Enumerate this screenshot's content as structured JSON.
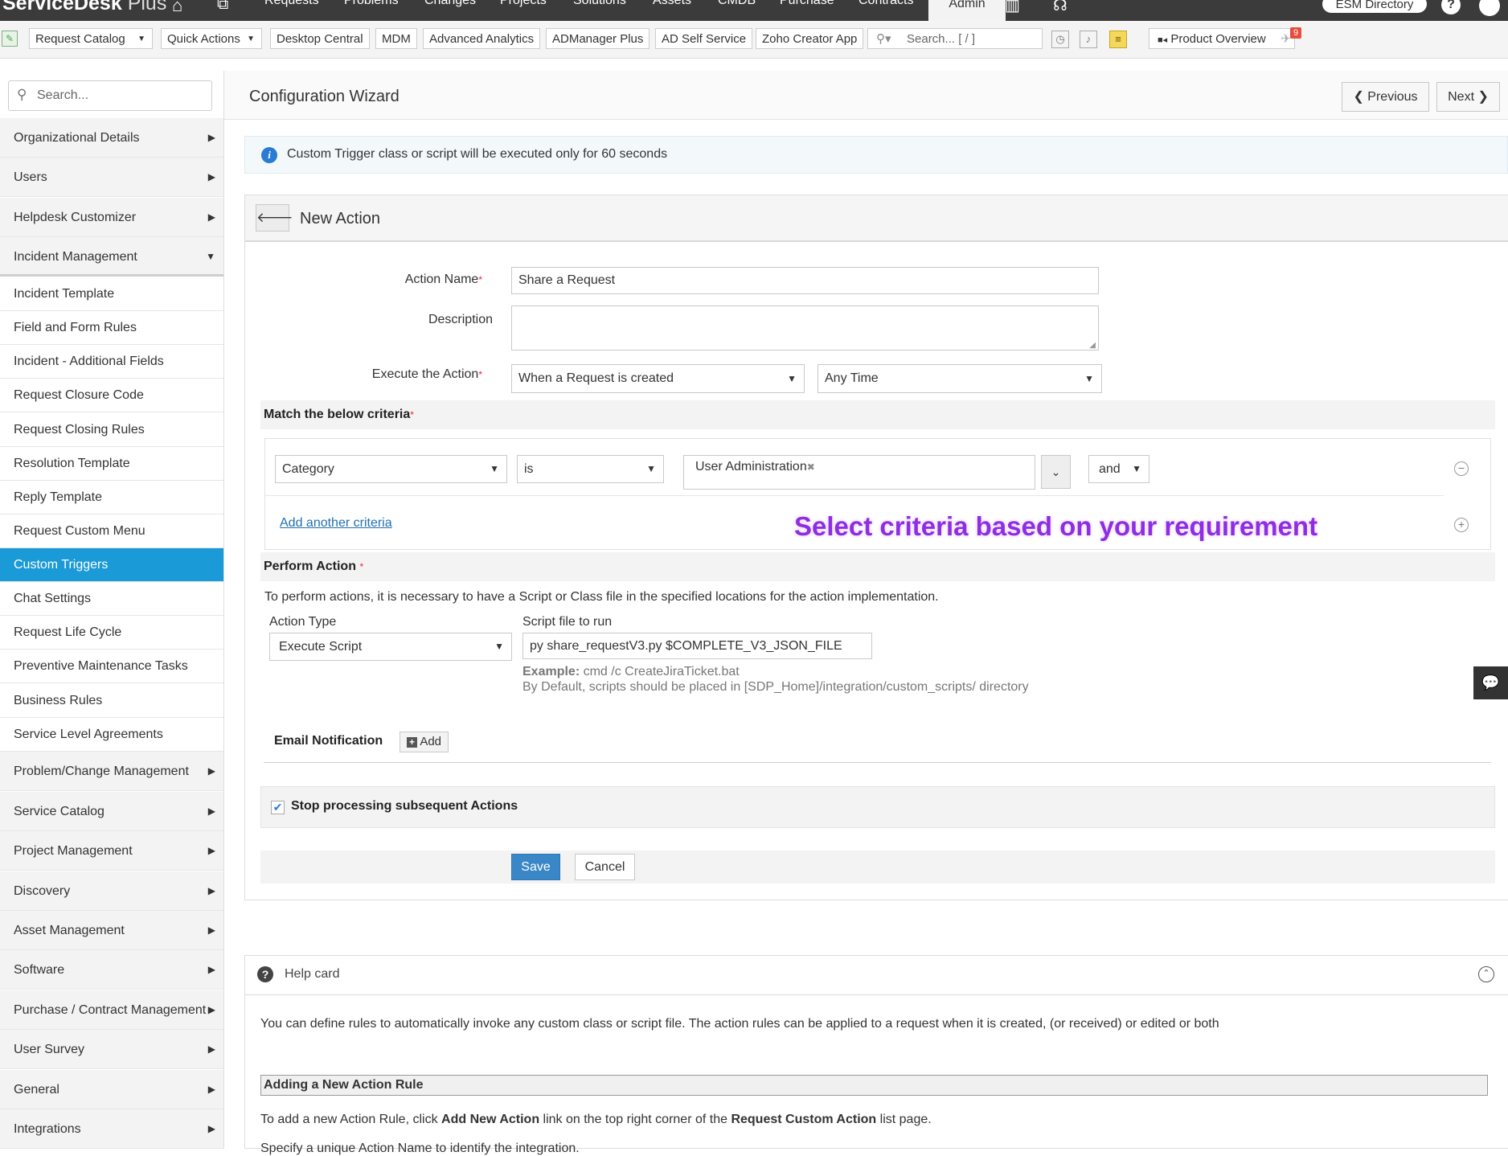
{
  "app": {
    "brand": "ServiceDesk",
    "brand_suffix": "Plus",
    "nav": [
      "Requests",
      "Problems",
      "Changes",
      "Projects",
      "Solutions",
      "Assets",
      "CMDB",
      "Purchase",
      "Contracts",
      "Admin"
    ],
    "esm_directory": "ESM Directory"
  },
  "toolbar": {
    "request_catalog": "Request Catalog",
    "quick_actions": "Quick Actions",
    "links": [
      "Desktop Central",
      "MDM",
      "Advanced Analytics",
      "ADManager Plus",
      "AD Self Service",
      "Zoho Creator App"
    ],
    "search_placeholder": "Search... [ / ]",
    "product_overview": "Product Overview",
    "badge_count": "9"
  },
  "sidebar": {
    "search_placeholder": "Search...",
    "groups_top": [
      "Organizational Details",
      "Users",
      "Helpdesk Customizer",
      "Incident Management"
    ],
    "sub_items": [
      "Incident Template",
      "Field and Form Rules",
      "Incident - Additional Fields",
      "Request Closure Code",
      "Request Closing Rules",
      "Resolution Template",
      "Reply Template",
      "Request Custom Menu",
      "Custom Triggers",
      "Chat Settings",
      "Request Life Cycle",
      "Preventive Maintenance Tasks",
      "Business Rules",
      "Service Level Agreements"
    ],
    "groups_bottom": [
      "Problem/Change Management",
      "Service Catalog",
      "Project Management",
      "Discovery",
      "Asset Management",
      "Software",
      "Purchase / Contract Management",
      "User Survey",
      "General",
      "Integrations"
    ],
    "active_item": "Custom Triggers"
  },
  "header": {
    "title": "Configuration Wizard",
    "previous": "Previous",
    "next": "Next"
  },
  "info_banner": "Custom Trigger class or script will be executed only for 60 seconds",
  "form": {
    "title": "New Action",
    "action_name_label": "Action Name",
    "action_name_value": "Share a Request",
    "description_label": "Description",
    "description_value": "",
    "execute_label": "Execute the Action",
    "execute_value": "When a Request is created",
    "execute_time": "Any Time",
    "criteria_title": "Match the below criteria",
    "criteria": {
      "field": "Category",
      "operator": "is",
      "value": "User Administration",
      "conjunction": "and"
    },
    "add_criteria": "Add another criteria",
    "annotation": "Select criteria based on your requirement",
    "perform_title": "Perform Action",
    "perform_note": "To perform actions, it is necessary to have a Script or Class file in the specified locations for the action implementation.",
    "action_type_label": "Action Type",
    "action_type_value": "Execute Script",
    "script_label": "Script file to run",
    "script_value": "py share_requestV3.py $COMPLETE_V3_JSON_FILE",
    "example_label": "Example:",
    "example_value": "cmd /c CreateJiraTicket.bat",
    "default_note": "By Default, scripts should be placed in [SDP_Home]/integration/custom_scripts/ directory",
    "email_label": "Email Notification",
    "email_add": "Add",
    "stop_processing": "Stop processing subsequent Actions",
    "save": "Save",
    "cancel": "Cancel"
  },
  "help": {
    "title": "Help card",
    "intro": "You can define rules to automatically invoke any custom class or script file. The action rules can be applied to a request when it is created, (or received) or edited or both",
    "section_title": "Adding a New Action Rule",
    "line_prefix": "To add a new Action Rule, click ",
    "line_link1": "Add New Action",
    "line_mid": " link on the top right corner of the ",
    "line_link2": "Request Custom Action",
    "line_suffix": " list page.",
    "line2": "Specify a unique Action Name to identify the integration."
  },
  "colors": {
    "topbar": "#3b3b3b",
    "active": "#1a9ad6",
    "save": "#3a87c8",
    "annotation": "#8e2de2",
    "info": "#2a7bd4"
  }
}
